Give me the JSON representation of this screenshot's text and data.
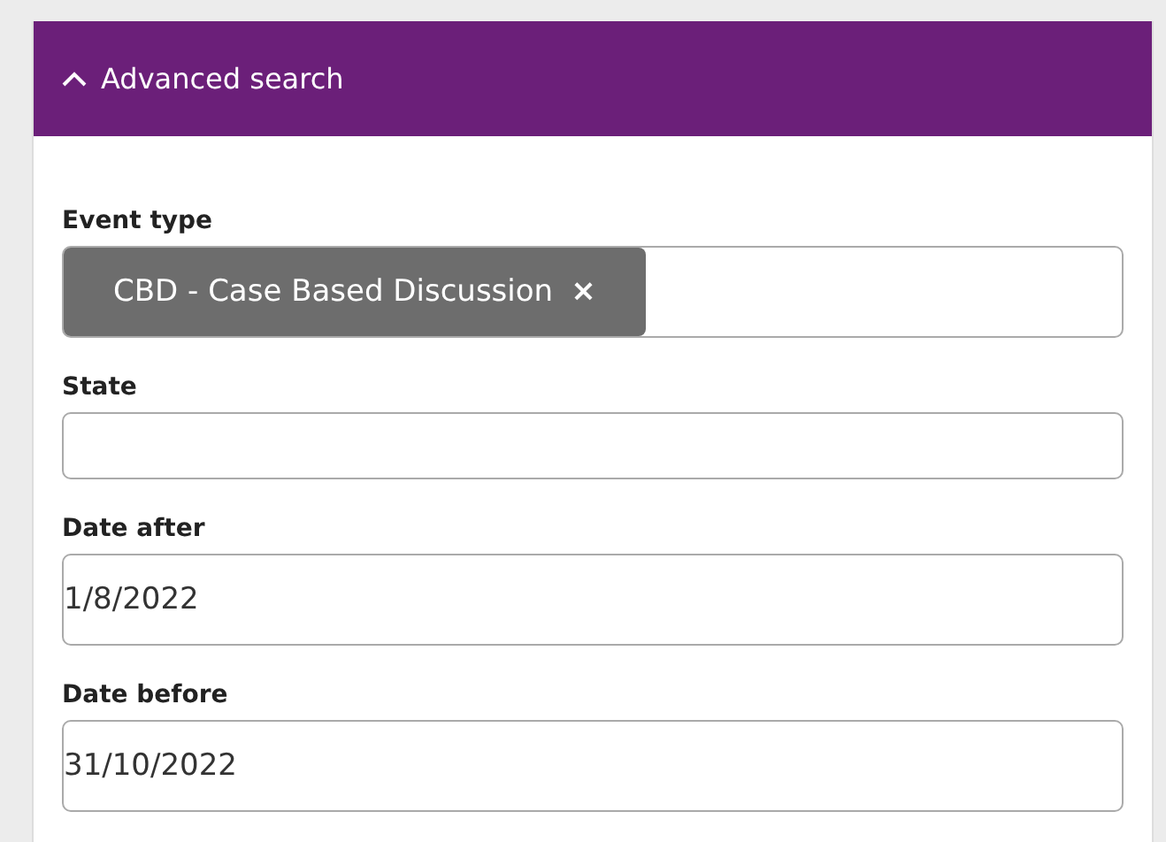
{
  "panel": {
    "title": "Advanced search",
    "expanded": true
  },
  "fields": [
    {
      "label": "Event type",
      "kind": "tags",
      "tags": [
        {
          "text": "CBD - Case Based Discussion",
          "remove": "×"
        }
      ]
    },
    {
      "label": "State",
      "kind": "text"
    },
    {
      "label": "Date after",
      "kind": "text",
      "value": "1/8/2022"
    },
    {
      "label": "Date before",
      "kind": "text",
      "value": "31/10/2022"
    }
  ]
}
